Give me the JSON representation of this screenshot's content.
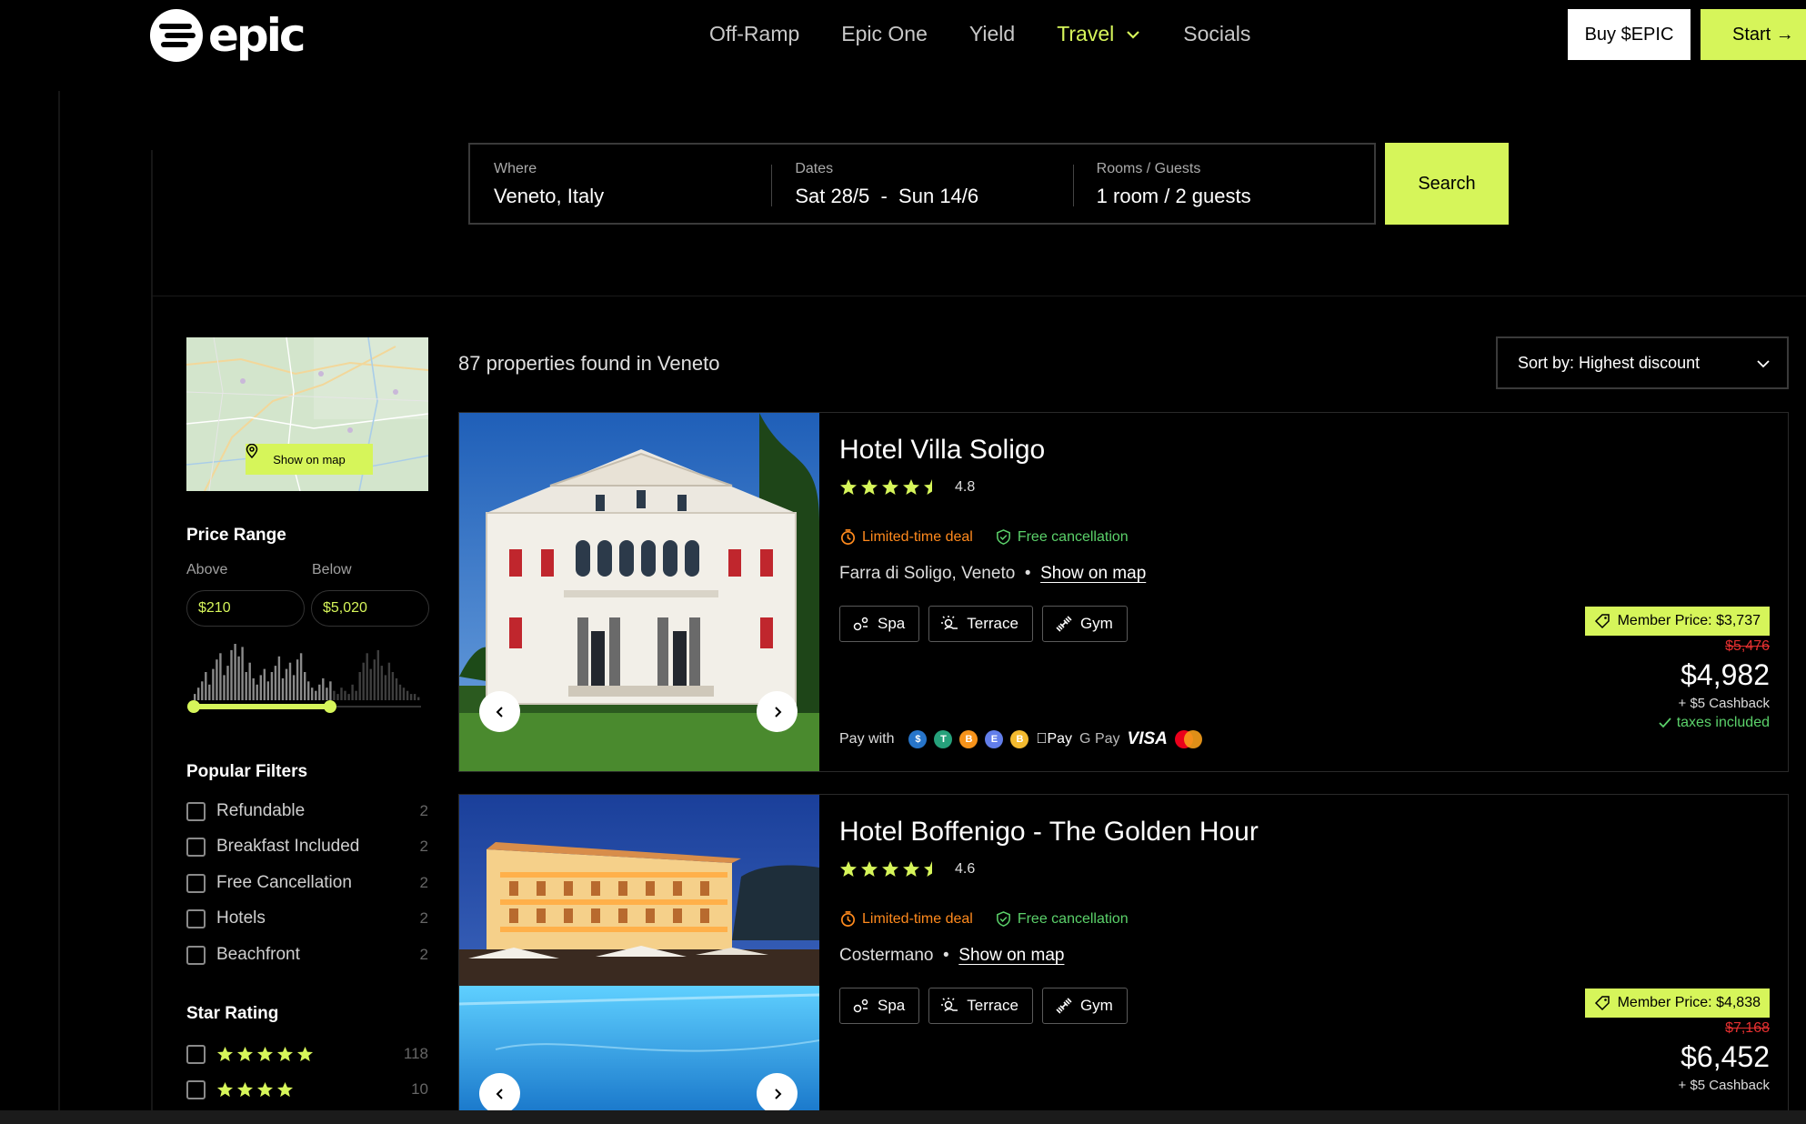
{
  "brand": {
    "name": "epic"
  },
  "nav": {
    "items": [
      "Off-Ramp",
      "Epic One",
      "Yield",
      "Travel",
      "Socials"
    ],
    "active": "Travel"
  },
  "header": {
    "buy_label": "Buy $EPIC",
    "start_label": "Start →"
  },
  "search": {
    "where_label": "Where",
    "where_value": "Veneto, Italy",
    "dates_label": "Dates",
    "dates_value": "Sat 28/5  -  Sun 14/6",
    "guests_label": "Rooms / Guests",
    "guests_value": "1 room / 2 guests",
    "button": "Search"
  },
  "sidebar": {
    "show_on_map": "Show on map",
    "price_range": {
      "title": "Price Range",
      "above_label": "Above",
      "below_label": "Below",
      "above_value": "$210",
      "below_value": "$5,020",
      "histogram": [
        2,
        4,
        6,
        9,
        5,
        10,
        13,
        15,
        8,
        11,
        16,
        18,
        14,
        17,
        9,
        12,
        7,
        5,
        8,
        10,
        6,
        9,
        11,
        14,
        7,
        10,
        12,
        8,
        13,
        15,
        9,
        6,
        4,
        3,
        5,
        7,
        4,
        6,
        3,
        2,
        4,
        3,
        2,
        5,
        3,
        9,
        12,
        15,
        10,
        13,
        16,
        11,
        8,
        12,
        9,
        7,
        5,
        4,
        3,
        2,
        2,
        1
      ],
      "slider_range": [
        0.0,
        0.6
      ]
    },
    "popular_filters": {
      "title": "Popular Filters",
      "items": [
        {
          "label": "Refundable",
          "count": "2"
        },
        {
          "label": "Breakfast Included",
          "count": "2"
        },
        {
          "label": "Free Cancellation",
          "count": "2"
        },
        {
          "label": "Hotels",
          "count": "2"
        },
        {
          "label": "Beachfront",
          "count": "2"
        }
      ]
    },
    "star_rating": {
      "title": "Star Rating",
      "items": [
        {
          "stars": 5,
          "count": "118"
        },
        {
          "stars": 4,
          "count": "10"
        }
      ]
    }
  },
  "results": {
    "count_text": "87 properties found in Veneto",
    "sort_label": "Sort by: Highest discount"
  },
  "pay_with_label": "Pay with",
  "pay_methods": [
    "Pay",
    "G Pay",
    "VISA"
  ],
  "hotels": [
    {
      "name": "Hotel Villa Soligo",
      "rating": "4.8",
      "deal": "Limited-time deal",
      "cancellation": "Free cancellation",
      "location": "Farra di Soligo, Veneto",
      "map_link": "Show on map",
      "amenities": [
        "Spa",
        "Terrace",
        "Gym"
      ],
      "member_price": "Member Price: $3,737",
      "old_price": "$5,476",
      "price": "$4,982",
      "cashback": "+ $5 Cashback",
      "taxes": "taxes included"
    },
    {
      "name": "Hotel Boffenigo - The Golden Hour",
      "rating": "4.6",
      "deal": "Limited-time deal",
      "cancellation": "Free cancellation",
      "location": "Costermano",
      "map_link": "Show on map",
      "amenities": [
        "Spa",
        "Terrace",
        "Gym"
      ],
      "member_price": "Member Price: $4,838",
      "old_price": "$7,168",
      "price": "$6,452",
      "cashback": "+ $5 Cashback"
    }
  ],
  "colors": {
    "accent": "#d6f55a",
    "deal": "#ff8a1d",
    "free": "#5bd16a",
    "strike": "#e53030"
  }
}
